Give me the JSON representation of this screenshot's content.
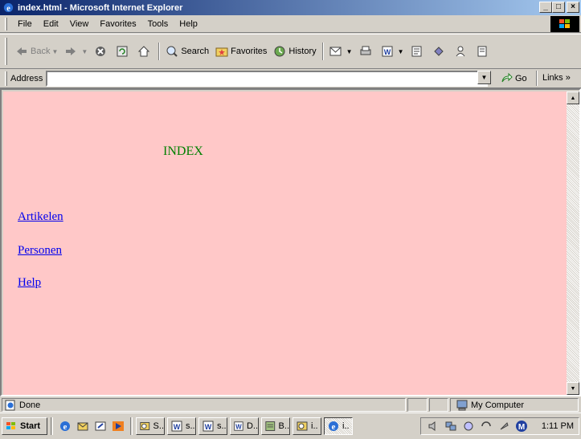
{
  "window": {
    "title": "index.html - Microsoft Internet Explorer",
    "minimize": "_",
    "maximize": "□",
    "close": "×"
  },
  "menu": {
    "items": [
      {
        "label": "File"
      },
      {
        "label": "Edit"
      },
      {
        "label": "View"
      },
      {
        "label": "Favorites"
      },
      {
        "label": "Tools"
      },
      {
        "label": "Help"
      }
    ]
  },
  "toolbar": {
    "back": "Back",
    "search": "Search",
    "favorites": "Favorites",
    "history": "History"
  },
  "address": {
    "label": "Address",
    "value": "",
    "go": "Go",
    "links": "Links »"
  },
  "page": {
    "heading": "INDEX",
    "links": [
      "Artikelen",
      "Personen",
      "Help"
    ]
  },
  "status": {
    "text": "Done",
    "zone": "My Computer"
  },
  "taskbar": {
    "start": "Start",
    "tasks": [
      "S..",
      "s..",
      "s..",
      "D..",
      "B..",
      "i..",
      "i.."
    ],
    "clock": "1:11 PM"
  },
  "colors": {
    "page_background": "#ffc8c8",
    "heading_color": "#008000",
    "link_color": "#0000ee",
    "titlebar_start": "#0a246a",
    "titlebar_end": "#a6caf0"
  }
}
